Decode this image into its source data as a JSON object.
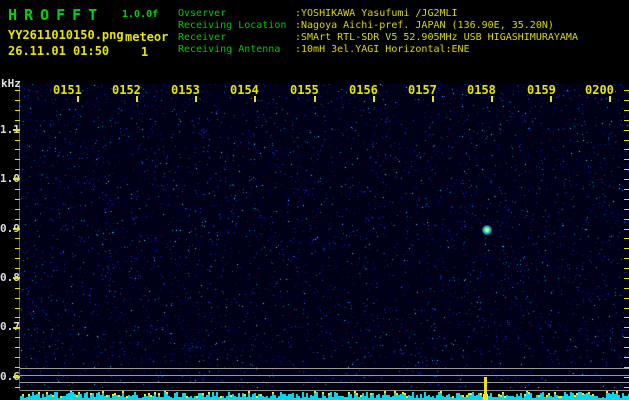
{
  "header": {
    "app_title": "HROFFT",
    "version": "1.0.0f",
    "filename": "YY2611010150.png",
    "mode": "meteor",
    "datetime": "26.11.01 01:50",
    "meteor_count": "1",
    "info": [
      {
        "label": "Ovserver",
        "value": ":YOSHIKAWA Yasufumi /JG2MLI"
      },
      {
        "label": "Receiving Location",
        "value": ":Nagoya Aichi-pref. JAPAN (136.90E, 35.20N)"
      },
      {
        "label": "Receiver",
        "value": ":SMArt RTL-SDR V5 52.905MHz USB HIGASHIMURAYAMA"
      },
      {
        "label": "Receiving Antenna",
        "value": ":10mH 3el.YAGI Horizontal:ENE"
      }
    ]
  },
  "spectrogram": {
    "freq_axis_unit": "kHz",
    "freq_labels": [
      "1.1",
      "1.0",
      "0.9",
      "0.8",
      "0.7",
      "0.6"
    ],
    "time_labels": [
      "0151",
      "0152",
      "0153",
      "0154",
      "0155",
      "0156",
      "0157",
      "0158",
      "0159",
      "0200"
    ]
  },
  "colors": {
    "green": "#00d400",
    "yellow": "#e6e600",
    "axis_white": "#dcdcdc",
    "cyan_level": "#00eaff",
    "noise_background": "#000016",
    "grid_grey": "#9a9a9a"
  }
}
